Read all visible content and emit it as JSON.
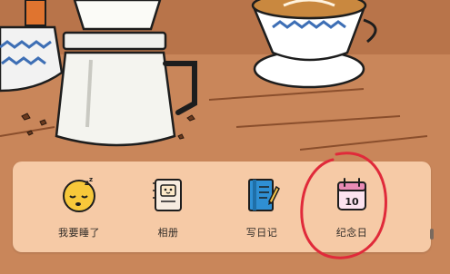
{
  "shortcuts": [
    {
      "label": "我要睡了",
      "icon": "sleepy-face-icon"
    },
    {
      "label": "相册",
      "icon": "photo-album-icon"
    },
    {
      "label": "写日记",
      "icon": "diary-notebook-icon"
    },
    {
      "label": "纪念日",
      "icon": "calendar-icon"
    }
  ],
  "calendar": {
    "day": "10"
  },
  "colors": {
    "tray": "#f6c8a2",
    "background": "#c9865a",
    "annotation_ring": "#e02a3a"
  }
}
